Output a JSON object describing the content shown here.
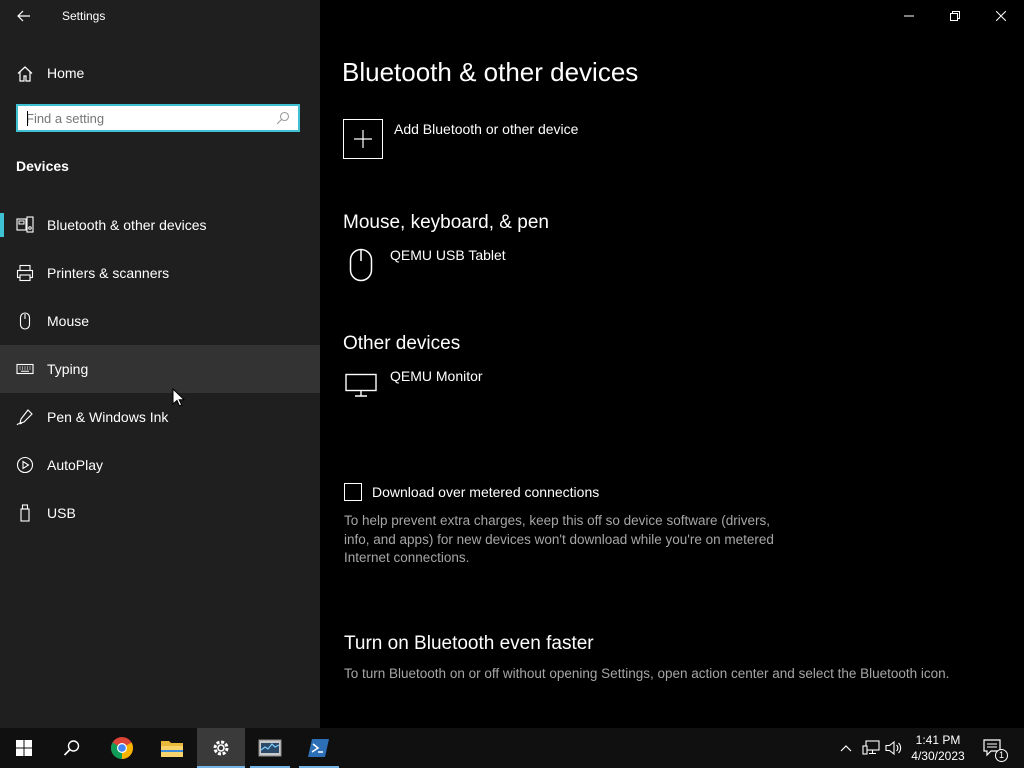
{
  "window": {
    "title": "Settings"
  },
  "sidebar": {
    "home_label": "Home",
    "search_placeholder": "Find a setting",
    "section_title": "Devices",
    "items": [
      {
        "label": "Bluetooth & other devices",
        "icon": "bluetooth-devices-icon",
        "selected": true
      },
      {
        "label": "Printers & scanners",
        "icon": "printer-icon"
      },
      {
        "label": "Mouse",
        "icon": "mouse-icon"
      },
      {
        "label": "Typing",
        "icon": "keyboard-icon",
        "hover": true
      },
      {
        "label": "Pen & Windows Ink",
        "icon": "pen-icon"
      },
      {
        "label": "AutoPlay",
        "icon": "autoplay-icon"
      },
      {
        "label": "USB",
        "icon": "usb-icon"
      }
    ]
  },
  "main": {
    "page_title": "Bluetooth & other devices",
    "add_device_label": "Add Bluetooth or other device",
    "groups": [
      {
        "title": "Mouse, keyboard, & pen",
        "devices": [
          {
            "label": "QEMU USB Tablet",
            "icon": "mouse-icon"
          }
        ]
      },
      {
        "title": "Other devices",
        "devices": [
          {
            "label": "QEMU Monitor",
            "icon": "monitor-icon"
          }
        ]
      }
    ],
    "metered": {
      "checkbox_label": "Download over metered connections",
      "checked": false,
      "help_text": "To help prevent extra charges, keep this off so device software (drivers, info, and apps) for new devices won't download while you're on metered Internet connections."
    },
    "faster": {
      "title": "Turn on Bluetooth even faster",
      "text": "To turn Bluetooth on or off without opening Settings, open action center and select the Bluetooth icon."
    }
  },
  "taskbar": {
    "time": "1:41 PM",
    "date": "4/30/2023",
    "notification_count": "1"
  },
  "colors": {
    "accent": "#3ec1d3",
    "sidebar_bg": "#1f1f1f",
    "main_bg": "#000000",
    "secondary_text": "#a6a6a6",
    "taskbar_bg": "#101010"
  }
}
